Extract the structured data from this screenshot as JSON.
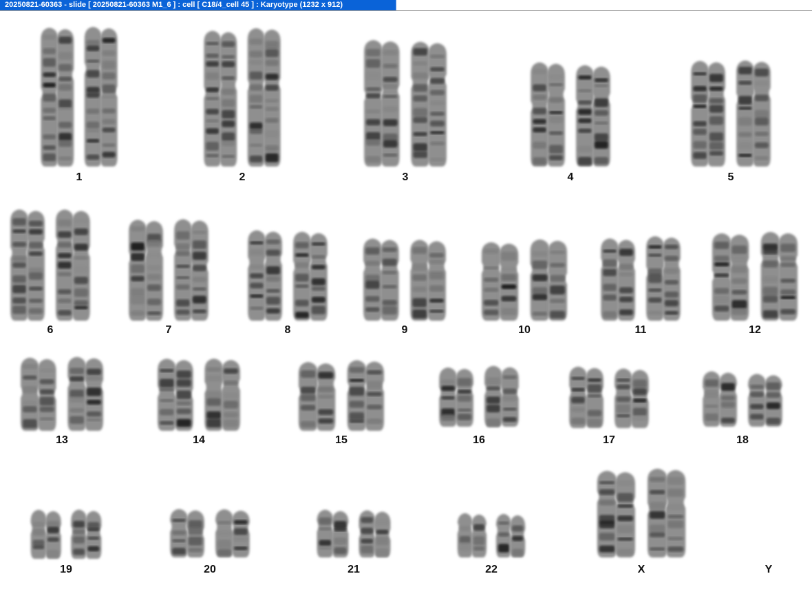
{
  "window": {
    "title": "20250821-60363 - slide [ 20250821-60363 M1_6 ] : cell [ C18/4_cell 45 ] : Karyotype  (1232 x 912)"
  },
  "karyotype": {
    "labels": [
      "1",
      "2",
      "3",
      "4",
      "5",
      "6",
      "7",
      "8",
      "9",
      "10",
      "11",
      "12",
      "13",
      "14",
      "15",
      "16",
      "17",
      "18",
      "19",
      "20",
      "21",
      "22",
      "X",
      "Y"
    ]
  }
}
